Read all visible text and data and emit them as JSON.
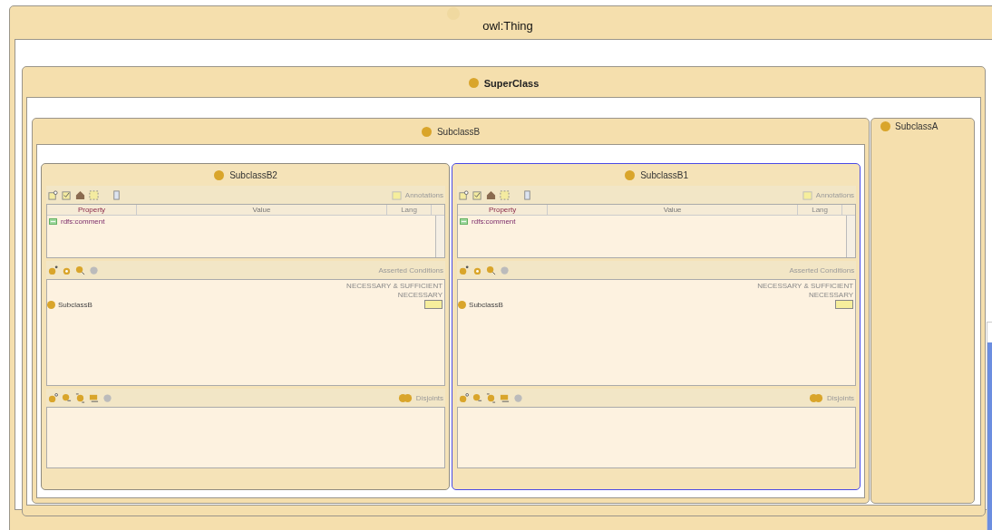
{
  "root": {
    "name": "owl:Thing",
    "children": [
      {
        "name": "SuperClass",
        "children": [
          {
            "name": "SubclassB",
            "children": [
              {
                "name": "SubclassB2",
                "selected": false,
                "form": {
                  "annotations_title": "Annotations",
                  "columns": [
                    "Property",
                    "Value",
                    "Lang"
                  ],
                  "rows": [
                    {
                      "property": "rdfs:comment"
                    }
                  ],
                  "conditions_title": "Asserted Conditions",
                  "condition_labels": [
                    "NECESSARY & SUFFICIENT",
                    "NECESSARY"
                  ],
                  "superclass": "SubclassB",
                  "disjoints_title": "Disjoints"
                }
              },
              {
                "name": "SubclassB1",
                "selected": true,
                "form": {
                  "annotations_title": "Annotations",
                  "columns": [
                    "Property",
                    "Value",
                    "Lang"
                  ],
                  "rows": [
                    {
                      "property": "rdfs:comment"
                    }
                  ],
                  "conditions_title": "Asserted Conditions",
                  "condition_labels": [
                    "NECESSARY & SUFFICIENT",
                    "NECESSARY"
                  ],
                  "superclass": "SubclassB",
                  "disjoints_title": "Disjoints"
                }
              }
            ]
          },
          {
            "name": "SubclassA"
          }
        ]
      }
    ]
  }
}
